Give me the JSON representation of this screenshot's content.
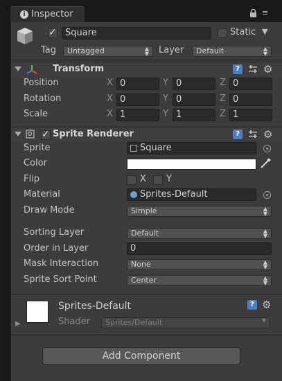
{
  "tab": {
    "title": "Inspector"
  },
  "object": {
    "name": "Square",
    "static_label": "Static",
    "tag_label": "Tag",
    "tag_value": "Untagged",
    "layer_label": "Layer",
    "layer_value": "Default"
  },
  "transform": {
    "title": "Transform",
    "rows": [
      {
        "label": "Position",
        "x": "0",
        "y": "0",
        "z": "0"
      },
      {
        "label": "Rotation",
        "x": "0",
        "y": "0",
        "z": "0"
      },
      {
        "label": "Scale",
        "x": "1",
        "y": "1",
        "z": "1"
      }
    ],
    "axes": [
      "X",
      "Y",
      "Z"
    ]
  },
  "sprite_renderer": {
    "title": "Sprite Renderer",
    "sprite_label": "Sprite",
    "sprite_value": "Square",
    "color_label": "Color",
    "color_value": "#ffffff",
    "flip_label": "Flip",
    "flip_x": "X",
    "flip_y": "Y",
    "material_label": "Material",
    "material_value": "Sprites-Default",
    "draw_mode_label": "Draw Mode",
    "draw_mode_value": "Simple",
    "sorting_layer_label": "Sorting Layer",
    "sorting_layer_value": "Default",
    "order_label": "Order in Layer",
    "order_value": "0",
    "mask_label": "Mask Interaction",
    "mask_value": "None",
    "sort_point_label": "Sprite Sort Point",
    "sort_point_value": "Center"
  },
  "material": {
    "name": "Sprites-Default",
    "shader_label": "Shader",
    "shader_value": "Sprites/Default"
  },
  "add_component": "Add Component",
  "colors": {
    "panel": "#3c3c3c",
    "field": "#2a2a2a",
    "help_blue": "#4d7fc2"
  }
}
